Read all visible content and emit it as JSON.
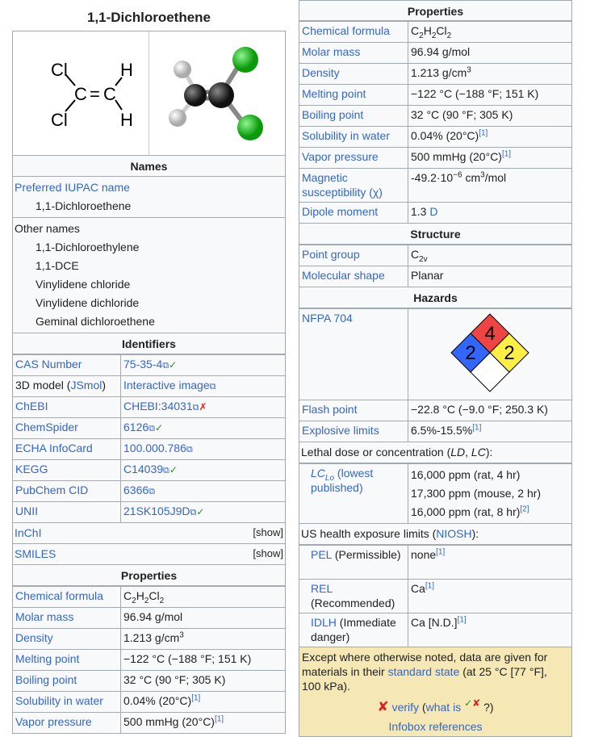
{
  "title": "1,1-Dichloroethene",
  "structure": {
    "cl1": "Cl",
    "cl2": "Cl",
    "c1": "C",
    "c2": "C",
    "eq": "=",
    "h1": "H",
    "h2": "H"
  },
  "colors": {
    "header_bg": "#f5e8b4",
    "link": "#3366cc",
    "nfpa_health": "#3366ff",
    "nfpa_fire": "#ef4444",
    "nfpa_reactivity": "#ffee44"
  },
  "names": {
    "header": "Names",
    "iupac_label": "Preferred IUPAC name",
    "iupac_value": "1,1-Dichloroethene",
    "other_label": "Other names",
    "other": [
      "1,1-Dichloroethylene",
      "1,1-DCE",
      "Vinylidene chloride",
      "Vinylidene dichloride",
      "Geminal dichloroethene"
    ]
  },
  "identifiers": {
    "header": "Identifiers",
    "cas_label": "CAS Number",
    "cas_value": "75-35-4",
    "model_label_a": "3D model (",
    "model_label_b": "JSmol",
    "model_label_c": ")",
    "model_value": "Interactive image",
    "chebi_label": "ChEBI",
    "chebi_value": "CHEBI:34031",
    "chemspider_label": "ChemSpider",
    "chemspider_value": "6126",
    "echa_label": "ECHA InfoCard",
    "echa_value": "100.000.786",
    "kegg_label": "KEGG",
    "kegg_value": "C14039",
    "pubchem_label": "PubChem CID",
    "pubchem_value": "6366",
    "unii_label": "UNII",
    "unii_value": "21SK105J9D",
    "inchi_label": "InChI",
    "smiles_label": "SMILES",
    "show": "[show]",
    "check": "✓",
    "cross": "✗"
  },
  "properties": {
    "header": "Properties",
    "formula_label": "Chemical formula",
    "formula": {
      "c": "C",
      "c_n": "2",
      "h": "H",
      "h_n": "2",
      "cl": "Cl",
      "cl_n": "2"
    },
    "molar_label": "Molar mass",
    "molar_value": "96.94 g/mol",
    "density_label": "Density",
    "density_value": "1.213 g/cm",
    "density_exp": "3",
    "melting_label": "Melting point",
    "melting_value": "−122 °C (−188 °F; 151 K)",
    "boiling_label": "Boiling point",
    "boiling_value": "32 °C (90 °F; 305 K)",
    "solubility_label": "Solubility in water",
    "solubility_value": "0.04% (20°C)",
    "vapor_label": "Vapor pressure",
    "vapor_value": "500 mmHg (20°C)",
    "magnetic_label_a": "Magnetic susceptibility (χ)",
    "magnetic_value_a": "-49.2·10",
    "magnetic_exp": "−6",
    "magnetic_value_b": " cm",
    "magnetic_exp2": "3",
    "magnetic_value_c": "/mol",
    "dipole_label": "Dipole moment",
    "dipole_value": "1.3 ",
    "dipole_unit": "D",
    "ref1": "[1]"
  },
  "structure_section": {
    "header": "Structure",
    "point_label": "Point group",
    "point_c": "C",
    "point_sub": "2v",
    "shape_label": "Molecular shape",
    "shape_value": "Planar"
  },
  "hazards": {
    "header": "Hazards",
    "nfpa_label": "NFPA 704",
    "nfpa_health": "2",
    "nfpa_fire": "4",
    "nfpa_reactivity": "2",
    "flash_label": "Flash point",
    "flash_value": "−22.8 °C (−9.0 °F; 250.3 K)",
    "explosive_label": "Explosive limits",
    "explosive_value": "6.5%-15.5%",
    "ref1": "[1]"
  },
  "lethal": {
    "header_a": "Lethal dose or concentration (",
    "header_ld": "LD",
    "header_sep": ", ",
    "header_lc": "LC",
    "header_b": "):",
    "lclo_a": "LC",
    "lclo_sub": "Lo",
    "lclo_b": " (lowest published)",
    "values": [
      "16,000 ppm (rat, 4 hr)",
      "17,300 ppm (mouse, 2 hr)",
      "16,000 ppm (rat, 8 hr)"
    ],
    "ref2": "[2]"
  },
  "exposure": {
    "header_a": "US health exposure limits (",
    "header_link": "NIOSH",
    "header_b": "):",
    "pel_link": "PEL",
    "pel_note": " (Permissible)",
    "pel_value": "none",
    "rel_link": "REL",
    "rel_note": " (Recommended)",
    "rel_value": "Ca",
    "idlh_link": "IDLH",
    "idlh_note": " (Immediate danger)",
    "idlh_value": "Ca [N.D.]",
    "ref1": "[1]"
  },
  "footer": {
    "text_a": "Except where otherwise noted, data are given for materials in their ",
    "link": "standard state",
    "text_b": " (at 25 °C [77 °F], 100 kPa).",
    "verify_cross": "✘",
    "verify": "verify",
    "what_a": "(",
    "what_link": "what is",
    "what_mark_ok": "✓",
    "what_mark_bad": "✘",
    "what_b": "?)",
    "references": "Infobox references"
  }
}
